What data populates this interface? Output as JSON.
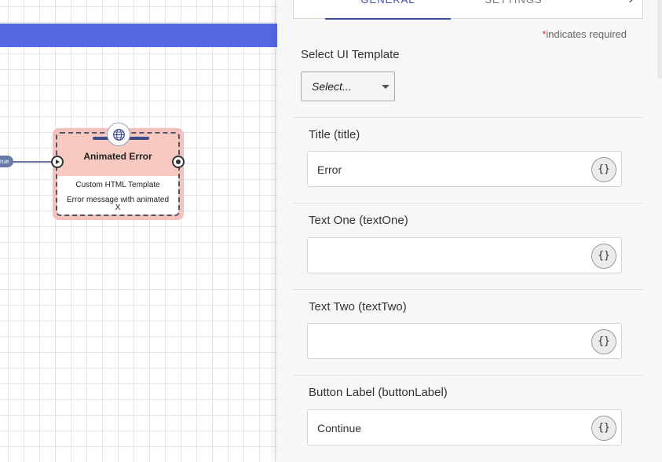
{
  "canvas": {
    "edge_label": "rue",
    "node": {
      "title": "Animated Error",
      "subtitle": "Custom HTML Template",
      "description": "Error message with animated X",
      "icon": "globe-icon"
    }
  },
  "panel": {
    "tabs": [
      {
        "label": "GENERAL",
        "active": true
      },
      {
        "label": "SETTINGS",
        "active": false
      }
    ],
    "tab_next_icon": "chevron-right-icon",
    "required_star": "*",
    "required_note": "indicates required",
    "template": {
      "label": "Select UI Template",
      "value": "Select..."
    },
    "fields": [
      {
        "label": "Title (title)",
        "value": "Error",
        "var_button": "{}"
      },
      {
        "label": "Text One (textOne)",
        "value": "",
        "var_button": "{}"
      },
      {
        "label": "Text Two (textTwo)",
        "value": "",
        "var_button": "{}"
      },
      {
        "label": "Button Label (buttonLabel)",
        "value": "Continue",
        "var_button": "{}"
      }
    ]
  },
  "colors": {
    "banner": "#5468e4",
    "node_fill": "#f7c9c1",
    "tab_active": "#3b4fae",
    "required_star": "#d9342b"
  }
}
